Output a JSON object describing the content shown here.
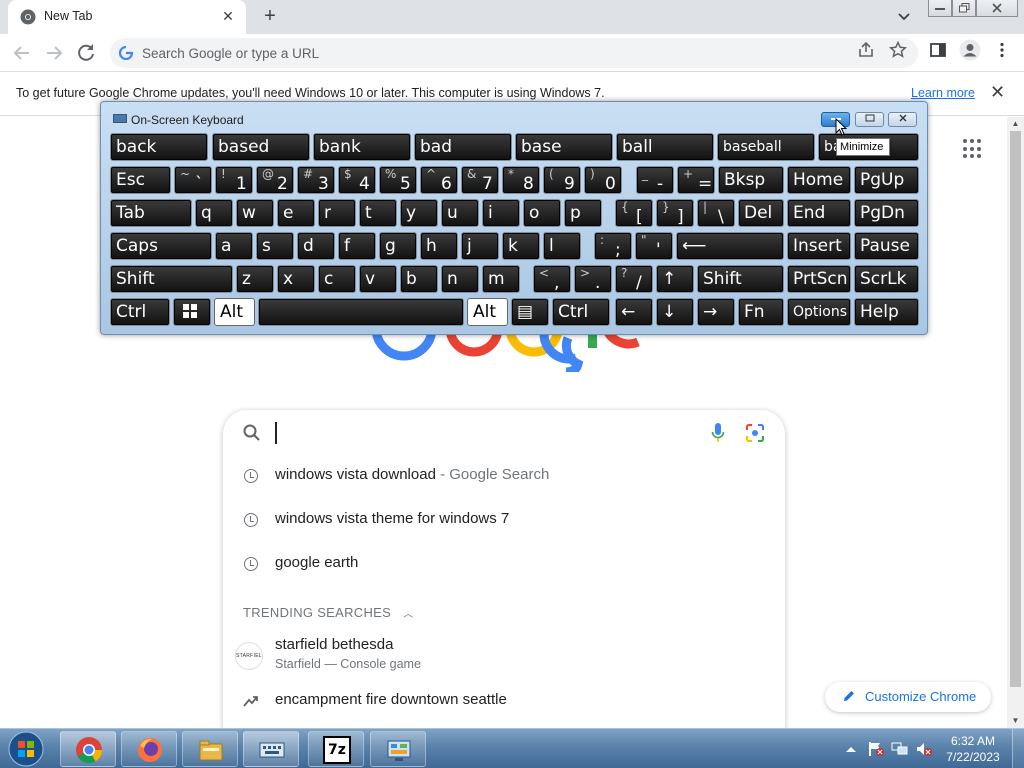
{
  "browser": {
    "tab": {
      "title": "New Tab",
      "close": "✕"
    },
    "new_tab": "+",
    "omnibox_placeholder": "Search Google or type a URL",
    "infobar": {
      "message": "To get future Google Chrome updates, you'll need Windows 10 or later. This computer is using Windows 7.",
      "link": "Learn more",
      "close": "✕"
    }
  },
  "google": {
    "suggestions": [
      {
        "text": "windows vista download",
        "suffix": " - Google Search"
      },
      {
        "text": "windows vista theme for windows 7",
        "suffix": ""
      },
      {
        "text": "google earth",
        "suffix": ""
      }
    ],
    "trending_header": "TRENDING SEARCHES",
    "trending": [
      {
        "title": "starfield bethesda",
        "subtitle": "Starfield — Console game",
        "thumb": "STARFIELD"
      },
      {
        "title": "encampment fire downtown seattle"
      }
    ],
    "customize": "Customize Chrome"
  },
  "osk": {
    "title": "On-Screen Keyboard",
    "tooltip": "Minimize",
    "predictions": [
      "back",
      "based",
      "bank",
      "bad",
      "base",
      "ball",
      "baseball",
      "ba"
    ],
    "row1": {
      "esc": "Esc",
      "keys": [
        {
          "sh": "~",
          "mn": "`"
        },
        {
          "sh": "!",
          "mn": "1"
        },
        {
          "sh": "@",
          "mn": "2"
        },
        {
          "sh": "#",
          "mn": "3"
        },
        {
          "sh": "$",
          "mn": "4"
        },
        {
          "sh": "%",
          "mn": "5"
        },
        {
          "sh": "^",
          "mn": "6"
        },
        {
          "sh": "&",
          "mn": "7"
        },
        {
          "sh": "*",
          "mn": "8"
        },
        {
          "sh": "(",
          "mn": "9"
        },
        {
          "sh": ")",
          "mn": "0"
        },
        {
          "sh": "_",
          "mn": "-"
        },
        {
          "sh": "+",
          "mn": "="
        }
      ],
      "bksp": "Bksp",
      "home": "Home",
      "pgup": "PgUp"
    },
    "row2": {
      "tab": "Tab",
      "letters": [
        "q",
        "w",
        "e",
        "r",
        "t",
        "y",
        "u",
        "i",
        "o",
        "p"
      ],
      "brackets": [
        {
          "sh": "{",
          "mn": "["
        },
        {
          "sh": "}",
          "mn": "]"
        },
        {
          "sh": "|",
          "mn": "\\"
        }
      ],
      "del": "Del",
      "end": "End",
      "pgdn": "PgDn"
    },
    "row3": {
      "caps": "Caps",
      "letters": [
        "a",
        "s",
        "d",
        "f",
        "g",
        "h",
        "j",
        "k",
        "l"
      ],
      "punct": [
        {
          "sh": ":",
          "mn": ";"
        },
        {
          "sh": "\"",
          "mn": "'"
        }
      ],
      "enter": "⟵",
      "insert": "Insert",
      "pause": "Pause"
    },
    "row4": {
      "shift": "Shift",
      "letters": [
        "z",
        "x",
        "c",
        "v",
        "b",
        "n",
        "m"
      ],
      "punct": [
        {
          "sh": "<",
          "mn": ","
        },
        {
          "sh": ">",
          "mn": "."
        },
        {
          "sh": "?",
          "mn": "/"
        }
      ],
      "up": "↑",
      "rshift": "Shift",
      "prtscn": "PrtScn",
      "scrlk": "ScrLk"
    },
    "row5": {
      "ctrl": "Ctrl",
      "win": "⊞",
      "alt": "Alt",
      "ralt": "Alt",
      "menu": "▤",
      "rctrl": "Ctrl",
      "left": "←",
      "down": "↓",
      "right": "→",
      "fn": "Fn",
      "options": "Options",
      "help": "Help"
    }
  },
  "taskbar": {
    "time": "6:32 AM",
    "date": "7/22/2023",
    "apps": [
      "chrome-icon",
      "firefox-icon",
      "explorer-icon",
      "on-screen-keyboard-icon",
      "7zip-icon",
      "control-panel-icon"
    ],
    "sevenzip": "7z"
  }
}
